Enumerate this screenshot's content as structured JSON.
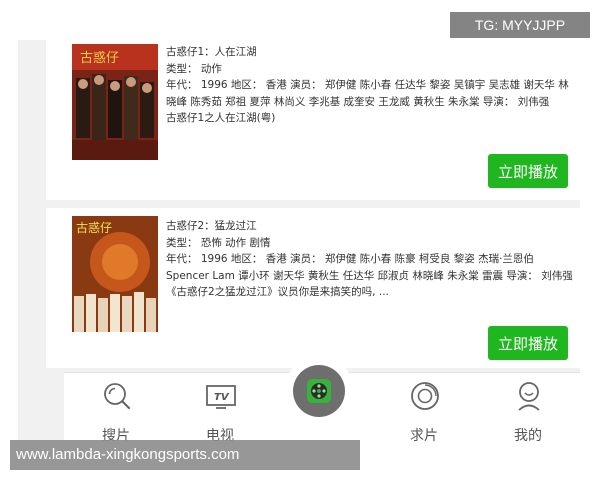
{
  "watermarks": {
    "top": "TG: MYYJJPP",
    "bottom": "www.lambda-xingkongsports.com"
  },
  "movies": [
    {
      "title": "古惑仔1：人在江湖",
      "genre": "类型： 动作",
      "details": "年代： 1996 地区： 香港 演员： 郑伊健 陈小春 任达华 黎姿 吴镇宇 吴志雄 谢天华 林晓峰 陈秀茹 郑祖 夏萍 林尚义 李兆基 成奎安 王龙威 黄秋生 朱永棠 导演： 刘伟强",
      "description": "古惑仔1之人在江湖(粤)",
      "poster_text": "古惑仔",
      "play_label": "立即播放"
    },
    {
      "title": "古惑仔2：猛龙过江",
      "genre": "类型： 恐怖 动作 剧情",
      "details": "年代： 1996 地区： 香港 演员： 郑伊健 陈小春 陈豪 柯受良 黎姿 杰瑞·兰恩伯 Spencer Lam 谭小环 谢天华 黄秋生 任达华 邱淑贞 林晓峰 朱永棠 雷震 导演： 刘伟强",
      "description": "《古惑仔2之猛龙过江》议员你是来搞笑的吗, ...",
      "poster_text": "古惑仔",
      "play_label": "立即播放"
    }
  ],
  "tabbar": {
    "tabs": [
      {
        "label": "搜片",
        "icon": "search-icon"
      },
      {
        "label": "电视",
        "icon": "tv-icon"
      },
      {
        "label": "求片",
        "icon": "request-icon"
      },
      {
        "label": "我的",
        "icon": "user-icon"
      }
    ],
    "tv_icon_text": "TV",
    "center_icon": "film-reel-icon"
  },
  "colors": {
    "play_button": "#1fb61f",
    "center_button": "#6e6e6e",
    "center_icon": "#37b33b"
  }
}
